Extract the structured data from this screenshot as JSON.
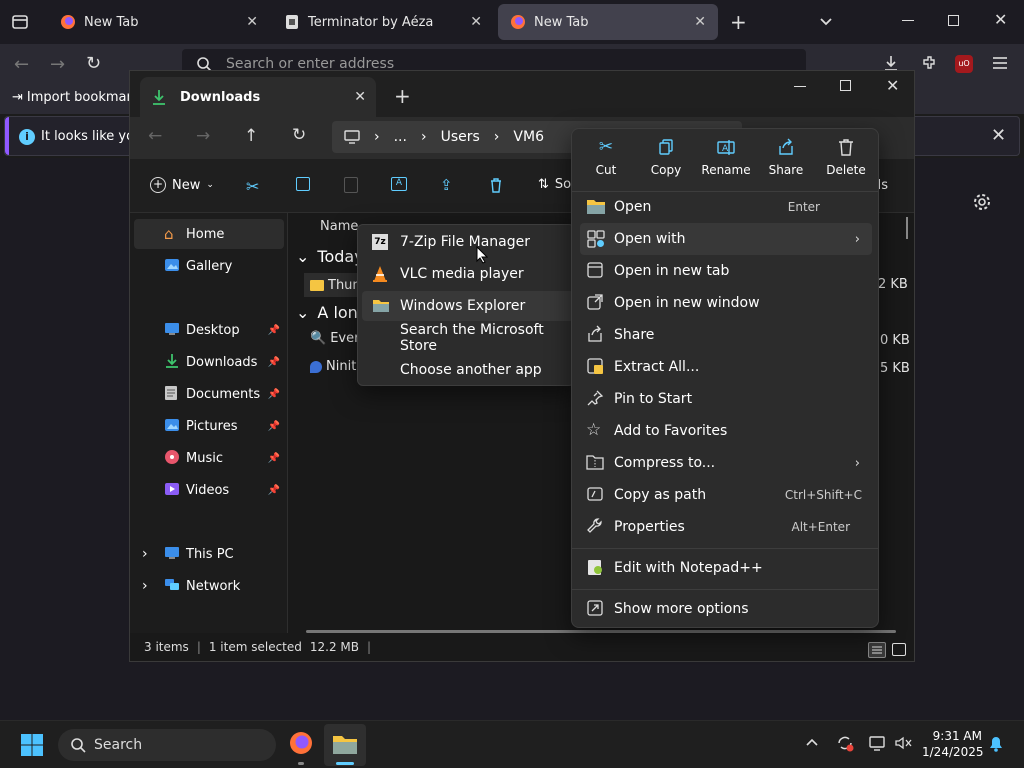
{
  "browser": {
    "tabs": [
      {
        "title": "New Tab"
      },
      {
        "title": "Terminator by Aéza"
      },
      {
        "title": "New Tab"
      }
    ],
    "url_placeholder": "Search or enter address",
    "bookmark_import": "Import bookmarks",
    "infobar_text": "It looks like you h"
  },
  "explorer": {
    "tab_title": "Downloads",
    "breadcrumb": [
      "...",
      "Users",
      "VM6"
    ],
    "new_label": "New",
    "sort_label": "So",
    "details_label": "ils",
    "column_name": "Name",
    "groups": [
      "Today",
      "A long"
    ],
    "files": [
      {
        "name": "Thun",
        "size": "2 KB"
      },
      {
        "name": "Every",
        "size": "0 KB"
      },
      {
        "name": "Ninite",
        "size": "5 KB"
      }
    ],
    "nav": [
      {
        "label": "Home"
      },
      {
        "label": "Gallery"
      },
      {
        "label": "Desktop"
      },
      {
        "label": "Downloads"
      },
      {
        "label": "Documents"
      },
      {
        "label": "Pictures"
      },
      {
        "label": "Music"
      },
      {
        "label": "Videos"
      },
      {
        "label": "This PC"
      },
      {
        "label": "Network"
      }
    ],
    "status": {
      "items": "3 items",
      "selected": "1 item selected",
      "size": "12.2 MB"
    }
  },
  "open_with_menu": [
    {
      "label": "7-Zip File Manager"
    },
    {
      "label": "VLC media player"
    },
    {
      "label": "Windows Explorer"
    },
    {
      "label": "Search the Microsoft Store"
    },
    {
      "label": "Choose another app"
    }
  ],
  "context_menu": {
    "top_actions": [
      {
        "label": "Cut"
      },
      {
        "label": "Copy"
      },
      {
        "label": "Rename"
      },
      {
        "label": "Share"
      },
      {
        "label": "Delete"
      }
    ],
    "items": [
      {
        "label": "Open",
        "shortcut": "Enter"
      },
      {
        "label": "Open with",
        "shortcut": ""
      },
      {
        "label": "Open in new tab",
        "shortcut": ""
      },
      {
        "label": "Open in new window",
        "shortcut": ""
      },
      {
        "label": "Share",
        "shortcut": ""
      },
      {
        "label": "Extract All...",
        "shortcut": ""
      },
      {
        "label": "Pin to Start",
        "shortcut": ""
      },
      {
        "label": "Add to Favorites",
        "shortcut": ""
      },
      {
        "label": "Compress to...",
        "shortcut": ""
      },
      {
        "label": "Copy as path",
        "shortcut": "Ctrl+Shift+C"
      },
      {
        "label": "Properties",
        "shortcut": "Alt+Enter"
      },
      {
        "label": "Edit with Notepad++",
        "shortcut": ""
      },
      {
        "label": "Show more options",
        "shortcut": ""
      }
    ]
  },
  "taskbar": {
    "search_label": "Search",
    "time": "9:31 AM",
    "date": "1/24/2025"
  },
  "colors": {
    "accent": "#60cdff",
    "folder": "#f5c542"
  }
}
